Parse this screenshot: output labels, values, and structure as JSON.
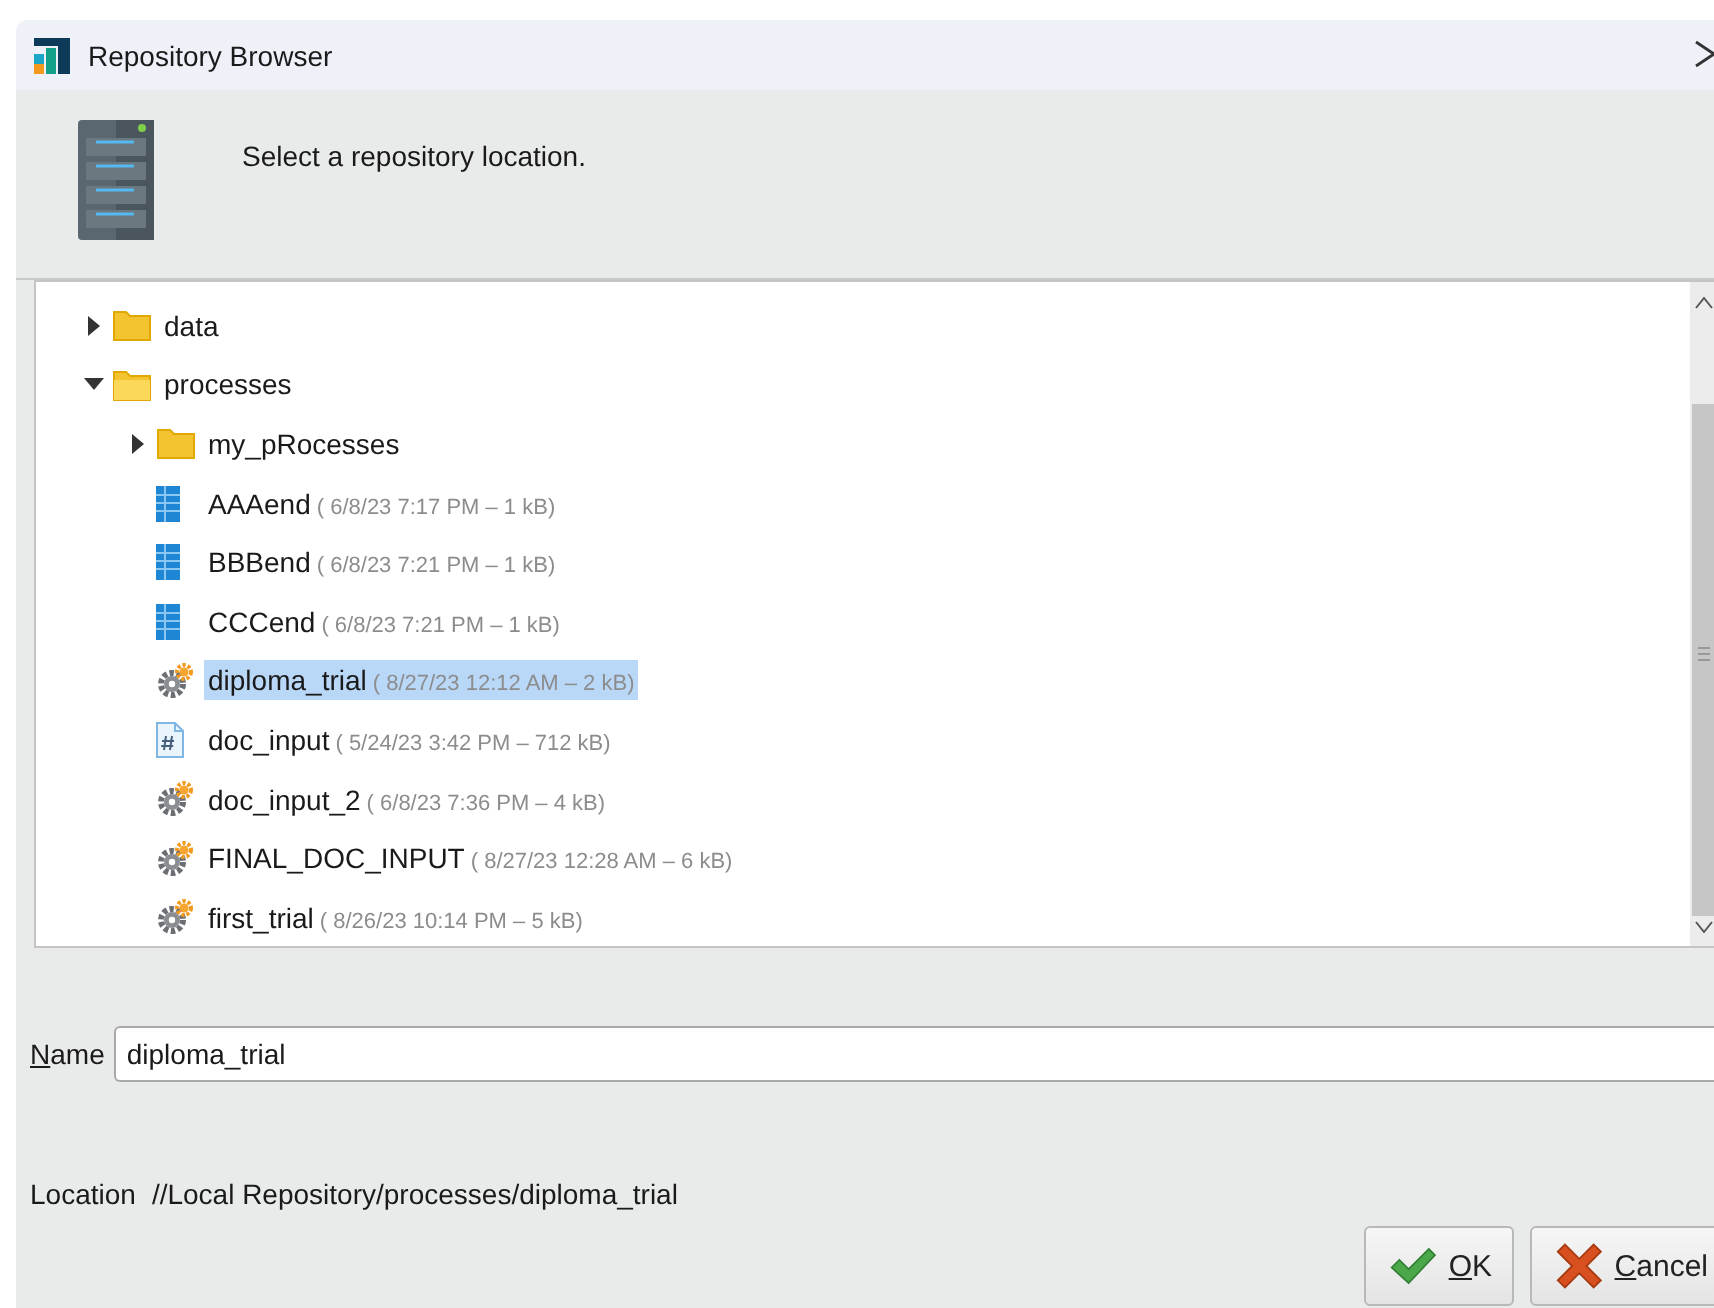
{
  "window": {
    "title": "Repository Browser"
  },
  "header": {
    "message": "Select a repository location."
  },
  "tree": {
    "items": [
      {
        "label": "data",
        "kind": "folder",
        "expanded": false,
        "selected": false
      },
      {
        "label": "processes",
        "kind": "folder",
        "expanded": true,
        "selected": false,
        "children": [
          {
            "label": "my_pRocesses",
            "kind": "folder",
            "expanded": false,
            "selected": false
          },
          {
            "label": "AAAend",
            "meta": "( 6/8/23 7:17 PM – 1 kB)",
            "kind": "data",
            "selected": false
          },
          {
            "label": "BBBend",
            "meta": "( 6/8/23 7:21 PM – 1 kB)",
            "kind": "data",
            "selected": false
          },
          {
            "label": "CCCend",
            "meta": "( 6/8/23 7:21 PM – 1 kB)",
            "kind": "data",
            "selected": false
          },
          {
            "label": "diploma_trial",
            "meta": "( 8/27/23 12:12 AM – 2 kB)",
            "kind": "process",
            "selected": true
          },
          {
            "label": "doc_input",
            "meta": "( 5/24/23 3:42 PM – 712 kB)",
            "kind": "text",
            "selected": false
          },
          {
            "label": "doc_input_2",
            "meta": "( 6/8/23 7:36 PM – 4 kB)",
            "kind": "process",
            "selected": false
          },
          {
            "label": "FINAL_DOC_INPUT",
            "meta": "( 8/27/23 12:28 AM – 6 kB)",
            "kind": "process",
            "selected": false
          },
          {
            "label": "first_trial",
            "meta": "( 8/26/23 10:14 PM – 5 kB)",
            "kind": "process",
            "selected": false
          }
        ]
      }
    ]
  },
  "name_field": {
    "label": "Name",
    "value": "diploma_trial"
  },
  "location": {
    "label": "Location",
    "value": "//Local Repository/processes/diploma_trial"
  },
  "buttons": [
    {
      "label": "OK",
      "kind": "ok"
    },
    {
      "label": "Cancel",
      "kind": "cancel"
    }
  ]
}
